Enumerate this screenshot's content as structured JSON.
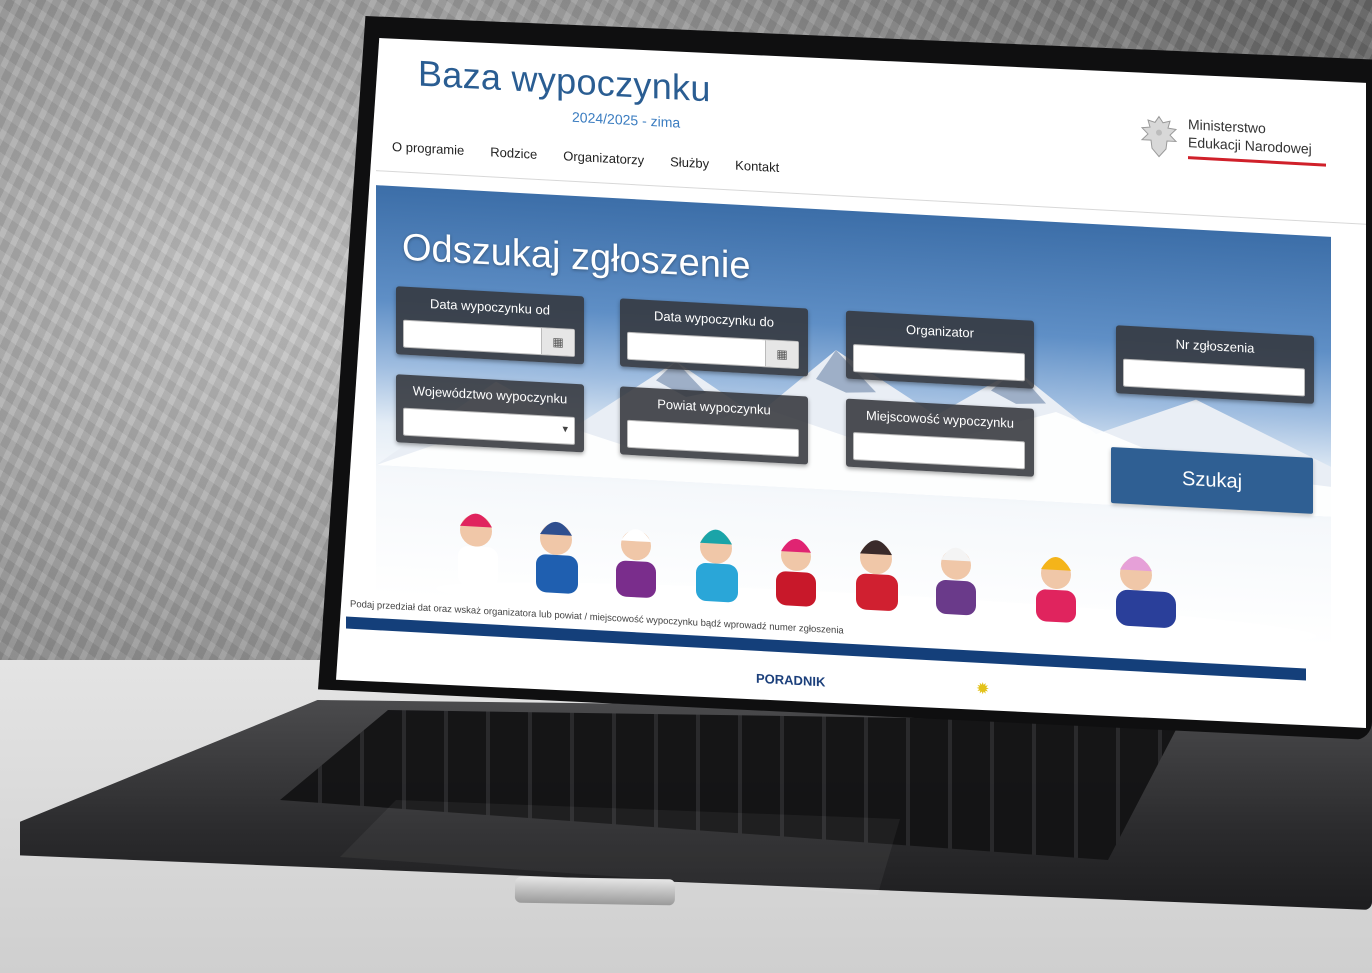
{
  "site": {
    "title": "Baza wypoczynku",
    "season": "2024/2025 - zima"
  },
  "ministry": {
    "line1": "Ministerstwo",
    "line2": "Edukacji Narodowej"
  },
  "nav": {
    "items": [
      {
        "label": "O programie"
      },
      {
        "label": "Rodzice"
      },
      {
        "label": "Organizatorzy"
      },
      {
        "label": "Służby"
      },
      {
        "label": "Kontakt"
      }
    ]
  },
  "search": {
    "title": "Odszukaj zgłoszenie",
    "fields": {
      "date_from": {
        "label": "Data wypoczynku od",
        "value": ""
      },
      "date_to": {
        "label": "Data wypoczynku do",
        "value": ""
      },
      "organizer": {
        "label": "Organizator",
        "value": ""
      },
      "application_no": {
        "label": "Nr zgłoszenia",
        "value": ""
      },
      "voivodeship": {
        "label": "Województwo wypoczynku",
        "value": ""
      },
      "county": {
        "label": "Powiat wypoczynku",
        "value": ""
      },
      "town": {
        "label": "Miejscowość wypoczynku",
        "value": ""
      }
    },
    "button_label": "Szukaj",
    "hint": "Podaj przedział dat oraz wskaż organizatora lub powiat / miejscowość wypoczynku bądź wprowadź numer zgłoszenia"
  },
  "footer_peek": {
    "label": "PORADNIK"
  },
  "colors": {
    "title_blue": "#2a5d92",
    "button_blue": "#2f5f93",
    "footer_bar": "#143f7a",
    "ministry_red": "#d0202a"
  },
  "icons": {
    "calendar": "calendar-icon",
    "dropdown": "chevron-down-icon",
    "emblem": "eagle-emblem-icon"
  }
}
